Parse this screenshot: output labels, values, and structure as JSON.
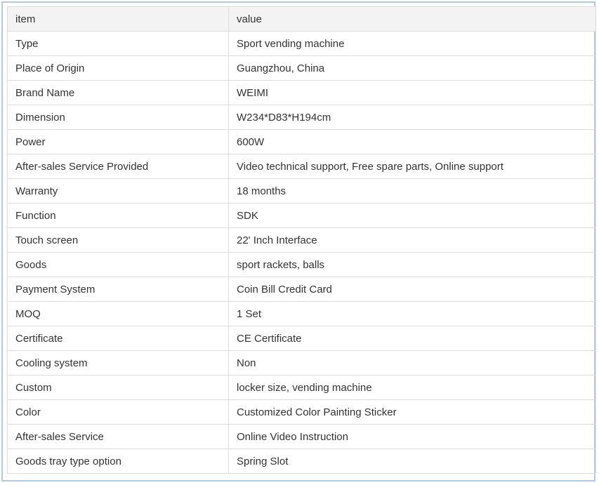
{
  "table": {
    "header": {
      "item": "item",
      "value": "value"
    },
    "rows": [
      {
        "item": "Type",
        "value": "Sport vending machine"
      },
      {
        "item": "Place of Origin",
        "value": "Guangzhou, China"
      },
      {
        "item": "Brand Name",
        "value": "WEIMI"
      },
      {
        "item": "Dimension",
        "value": "W234*D83*H194cm"
      },
      {
        "item": "Power",
        "value": "600W"
      },
      {
        "item": "After-sales Service Provided",
        "value": "Video technical support, Free spare parts, Online support"
      },
      {
        "item": "Warranty",
        "value": "18 months"
      },
      {
        "item": "Function",
        "value": "SDK"
      },
      {
        "item": "Touch screen",
        "value": "22' Inch Interface"
      },
      {
        "item": "Goods",
        "value": "sport rackets, balls"
      },
      {
        "item": "Payment System",
        "value": "Coin Bill Credit Card"
      },
      {
        "item": "MOQ",
        "value": "1 Set"
      },
      {
        "item": "Certificate",
        "value": "CE Certificate"
      },
      {
        "item": "Cooling system",
        "value": "Non"
      },
      {
        "item": "Custom",
        "value": "locker size, vending machine"
      },
      {
        "item": "Color",
        "value": "Customized Color Painting Sticker"
      },
      {
        "item": "After-sales Service",
        "value": "Online Video Instruction"
      },
      {
        "item": "Goods tray type option",
        "value": "Spring Slot"
      }
    ]
  }
}
